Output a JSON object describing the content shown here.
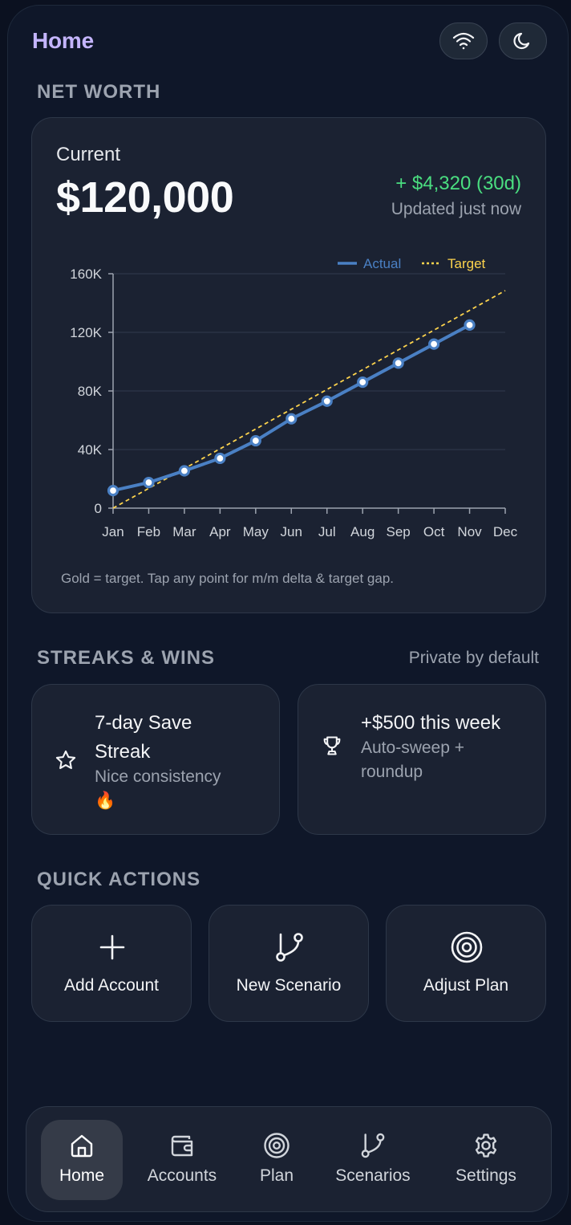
{
  "header": {
    "title": "Home",
    "wifi_icon": "wifi-icon",
    "theme_icon": "moon-icon"
  },
  "net_worth": {
    "section_title": "NET WORTH",
    "current_label": "Current",
    "amount": "$120,000",
    "delta": "+ $4,320 (30d)",
    "updated": "Updated just now",
    "footnote": "Gold = target. Tap any point for m/m delta & target gap."
  },
  "chart_data": {
    "type": "line",
    "x": [
      "Jan",
      "Feb",
      "Mar",
      "Apr",
      "May",
      "Jun",
      "Jul",
      "Aug",
      "Sep",
      "Oct",
      "Nov",
      "Dec"
    ],
    "series": [
      {
        "name": "Actual",
        "color": "#4a80c4",
        "values": [
          12000,
          17500,
          25500,
          34000,
          46000,
          61000,
          73000,
          86000,
          99000,
          112000,
          125000
        ]
      },
      {
        "name": "Target",
        "color": "#fcd34d",
        "dash": true,
        "values": [
          0,
          13500,
          27000,
          40500,
          54000,
          67500,
          81000,
          94500,
          108000,
          121500,
          135000,
          148500
        ]
      }
    ],
    "yticks": [
      "0",
      "40K",
      "80K",
      "120K",
      "160K"
    ],
    "ytick_values": [
      0,
      40000,
      80000,
      120000,
      160000
    ],
    "ylim": [
      0,
      160000
    ],
    "legend": "top-right"
  },
  "streaks": {
    "section_title": "STREAKS & WINS",
    "note": "Private by default",
    "cards": [
      {
        "icon": "star-icon",
        "title_line1": "7-day Save",
        "title_line2": "Streak",
        "sub_line1": "Nice consistency",
        "sub_line2": "🔥"
      },
      {
        "icon": "trophy-icon",
        "title_line1": "+$500 this week",
        "sub_line1": "Auto-sweep +",
        "sub_line2": "roundup"
      }
    ]
  },
  "quick_actions": {
    "section_title": "QUICK ACTIONS",
    "items": [
      {
        "icon": "plus-icon",
        "label": "Add Account"
      },
      {
        "icon": "branch-icon",
        "label": "New Scenario"
      },
      {
        "icon": "target-icon",
        "label": "Adjust Plan"
      }
    ]
  },
  "nav": {
    "items": [
      {
        "icon": "home-icon",
        "label": "Home",
        "active": true
      },
      {
        "icon": "wallet-icon",
        "label": "Accounts"
      },
      {
        "icon": "target-icon",
        "label": "Plan"
      },
      {
        "icon": "branch-icon",
        "label": "Scenarios"
      },
      {
        "icon": "gear-icon",
        "label": "Settings"
      }
    ]
  },
  "colors": {
    "accent": "#c4b5fd",
    "positive": "#4ade80",
    "actual": "#4a80c4",
    "target": "#fcd34d"
  }
}
